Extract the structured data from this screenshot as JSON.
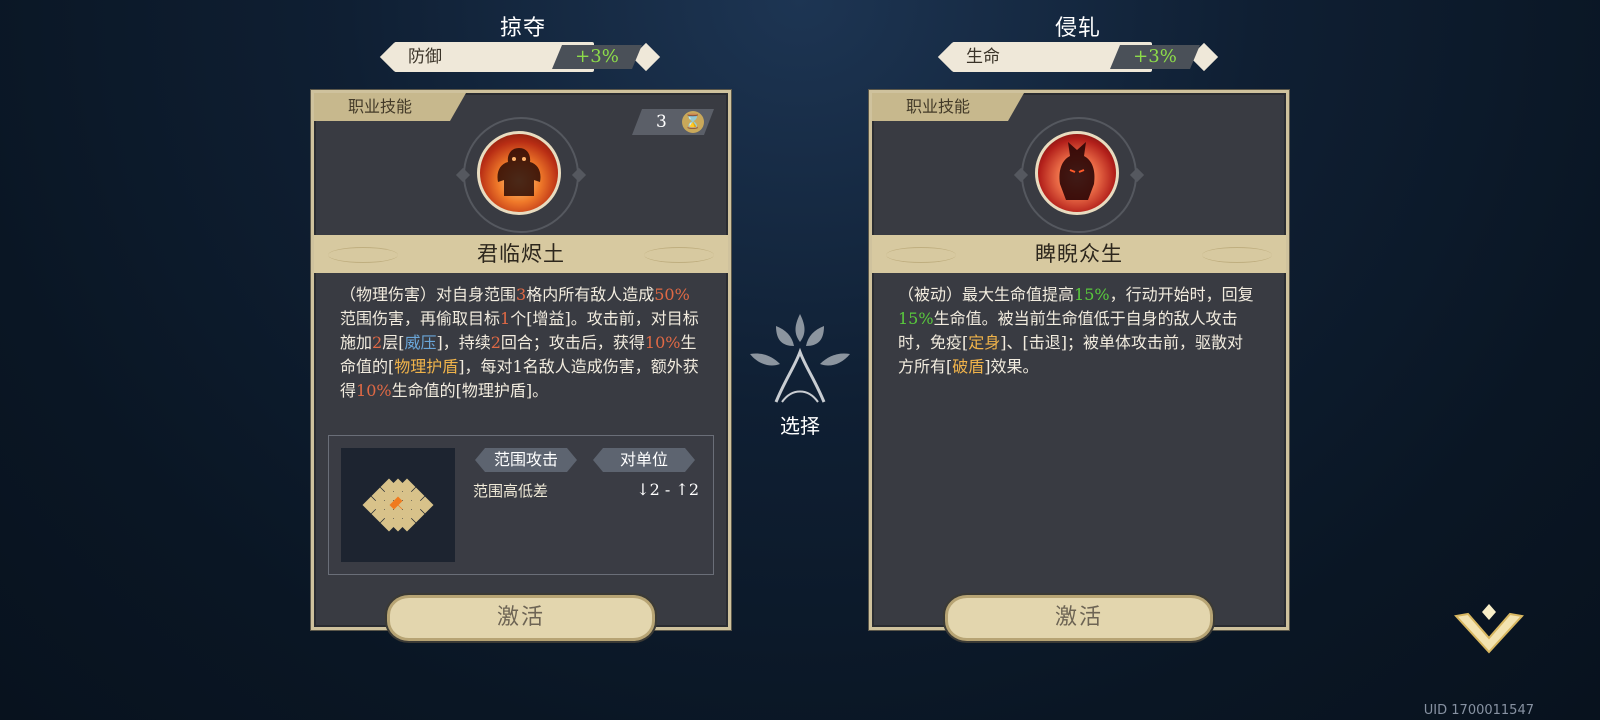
{
  "left": {
    "option_title": "掠夺",
    "stat_name": "防御",
    "stat_value": "+3%",
    "card": {
      "tag": "职业技能",
      "cooldown": "3",
      "skill_name": "君临烬土",
      "description_parts": [
        {
          "text": "（物理伤害）对自身范围",
          "c": ""
        },
        {
          "text": "3",
          "c": "o"
        },
        {
          "text": "格内所有敌人造成",
          "c": ""
        },
        {
          "text": "50%",
          "c": "o"
        },
        {
          "text": "范围伤害，再偷取目标",
          "c": ""
        },
        {
          "text": "1",
          "c": "o"
        },
        {
          "text": "个[增益]。攻击前，对目标施加",
          "c": ""
        },
        {
          "text": "2",
          "c": "o"
        },
        {
          "text": "层[",
          "c": ""
        },
        {
          "text": "威压",
          "c": "b"
        },
        {
          "text": "]，持续",
          "c": ""
        },
        {
          "text": "2",
          "c": "o"
        },
        {
          "text": "回合；攻击后，获得",
          "c": ""
        },
        {
          "text": "10%",
          "c": "o"
        },
        {
          "text": "生命值的[",
          "c": ""
        },
        {
          "text": "物理护盾",
          "c": "y"
        },
        {
          "text": "]，每对1名敌人造成伤害，额外获得",
          "c": ""
        },
        {
          "text": "10%",
          "c": "o"
        },
        {
          "text": "生命值的[物理护盾]。",
          "c": ""
        }
      ],
      "range_tag_1": "范围攻击",
      "range_tag_2": "对单位",
      "range_label": "范围高低差",
      "range_value": "↓2 - ↑2",
      "activate_label": "激活"
    }
  },
  "right": {
    "option_title": "侵轧",
    "stat_name": "生命",
    "stat_value": "+3%",
    "card": {
      "tag": "职业技能",
      "skill_name": "睥睨众生",
      "description_parts": [
        {
          "text": "（被动）最大生命值提高",
          "c": ""
        },
        {
          "text": "15%",
          "c": "g"
        },
        {
          "text": "，行动开始时，回复",
          "c": ""
        },
        {
          "text": "15%",
          "c": "g"
        },
        {
          "text": "生命值。被当前生命值低于自身的敌人攻击时，免疫[",
          "c": ""
        },
        {
          "text": "定身",
          "c": "y"
        },
        {
          "text": "]、[击退]；被单体攻击前，驱散对方所有[",
          "c": ""
        },
        {
          "text": "破盾",
          "c": "y"
        },
        {
          "text": "]效果。",
          "c": ""
        }
      ],
      "activate_label": "激活"
    }
  },
  "center": {
    "choose_label": "选择"
  },
  "footer": {
    "uid": "UID 1700011547"
  },
  "icons": {
    "cooldown": "hourglass-icon",
    "choose": "tree-emblem-icon",
    "collapse": "chevron-down-icon"
  },
  "colors": {
    "highlight_orange": "#e06945",
    "highlight_yellow": "#f0b34a",
    "highlight_blue": "#6aa6d8",
    "highlight_green": "#59c93d",
    "stat_value_green": "#8ddc4a"
  }
}
